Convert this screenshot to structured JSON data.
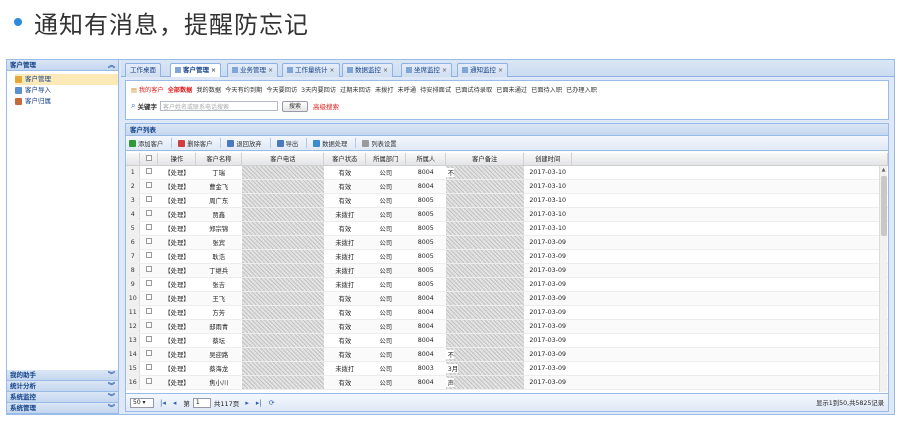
{
  "slide": {
    "title": "通知有消息，提醒防忘记"
  },
  "sidebar": {
    "top_header": "客户管理",
    "items": [
      {
        "label": "客户管理",
        "active": true,
        "icon": "users-icon"
      },
      {
        "label": "客户导入",
        "active": false,
        "icon": "import-icon"
      },
      {
        "label": "客户归属",
        "active": false,
        "icon": "assign-icon"
      }
    ],
    "bottom_sections": [
      {
        "label": "我的助手"
      },
      {
        "label": "统计分析"
      },
      {
        "label": "系统监控"
      },
      {
        "label": "系统管理"
      }
    ]
  },
  "tabs": [
    {
      "label": "工作桌面",
      "active": false,
      "closable": false
    },
    {
      "label": "客户管理",
      "active": true,
      "closable": true
    },
    {
      "label": "业务管理",
      "active": false,
      "closable": true
    },
    {
      "label": "工作量统计",
      "active": false,
      "closable": true
    },
    {
      "label": "数据监控",
      "active": false,
      "closable": true
    },
    {
      "label": "坐席监控",
      "active": false,
      "closable": true
    },
    {
      "label": "通知监控",
      "active": false,
      "closable": true
    }
  ],
  "filters": {
    "quick": [
      {
        "label": "我的客户",
        "style": "red"
      },
      {
        "label": "全部数据",
        "style": "redb"
      },
      {
        "label": "我的数据",
        "style": ""
      },
      {
        "label": "今天有约到期",
        "style": ""
      },
      {
        "label": "今天要回访",
        "style": ""
      },
      {
        "label": "3天内要回访",
        "style": ""
      },
      {
        "label": "过期未回访",
        "style": ""
      },
      {
        "label": "未拨打",
        "style": ""
      },
      {
        "label": "未呼通",
        "style": ""
      },
      {
        "label": "待安排面试",
        "style": ""
      },
      {
        "label": "已面试待录取",
        "style": ""
      },
      {
        "label": "已面未通过",
        "style": ""
      },
      {
        "label": "已面待入职",
        "style": ""
      },
      {
        "label": "已办理入职",
        "style": ""
      }
    ],
    "keyword_label": "关键字",
    "search_placeholder": "客户姓名或联系电话搜索",
    "search_button": "搜索",
    "advanced_link": "高级搜索"
  },
  "list": {
    "title": "客户列表",
    "toolbar": [
      {
        "label": "添加客户",
        "icon": "add-icon",
        "color": "#2e9a3a"
      },
      {
        "label": "删除客户",
        "icon": "delete-icon",
        "color": "#d23c3c"
      },
      {
        "label": "退回放弃",
        "icon": "return-icon",
        "color": "#4a79c2"
      },
      {
        "label": "导出",
        "icon": "export-icon",
        "color": "#4a79c2"
      },
      {
        "label": "数据处理",
        "icon": "process-icon",
        "color": "#3a8bd0"
      },
      {
        "label": "列表设置",
        "icon": "settings-icon",
        "color": "#9a9a9a"
      }
    ],
    "columns": [
      "",
      "",
      "操作",
      "客户名称",
      "客户电话",
      "客户状态",
      "所属部门",
      "所属人",
      "客户备注",
      "创建时间"
    ],
    "rows": [
      {
        "n": "1",
        "op": "【处理】",
        "name": "丁瑞",
        "status": "有效",
        "dept": "公司",
        "owner": "8004",
        "note": "不",
        "date": "2017-03-10"
      },
      {
        "n": "2",
        "op": "【处理】",
        "name": "曹金飞",
        "status": "有效",
        "dept": "公司",
        "owner": "8004",
        "note": "",
        "date": "2017-03-10"
      },
      {
        "n": "3",
        "op": "【处理】",
        "name": "周广东",
        "status": "有效",
        "dept": "公司",
        "owner": "8005",
        "note": "",
        "date": "2017-03-10"
      },
      {
        "n": "4",
        "op": "【处理】",
        "name": "贾鑫",
        "status": "未拨打",
        "dept": "公司",
        "owner": "8005",
        "note": "",
        "date": "2017-03-10"
      },
      {
        "n": "5",
        "op": "【处理】",
        "name": "郑宗锦",
        "status": "有效",
        "dept": "公司",
        "owner": "8005",
        "note": "",
        "date": "2017-03-10"
      },
      {
        "n": "6",
        "op": "【处理】",
        "name": "张宾",
        "status": "未拨打",
        "dept": "公司",
        "owner": "8005",
        "note": "",
        "date": "2017-03-09"
      },
      {
        "n": "7",
        "op": "【处理】",
        "name": "耿浩",
        "status": "未拨打",
        "dept": "公司",
        "owner": "8005",
        "note": "",
        "date": "2017-03-09"
      },
      {
        "n": "8",
        "op": "【处理】",
        "name": "丁继兵",
        "status": "未拨打",
        "dept": "公司",
        "owner": "8005",
        "note": "",
        "date": "2017-03-09"
      },
      {
        "n": "9",
        "op": "【处理】",
        "name": "张吉",
        "status": "未拨打",
        "dept": "公司",
        "owner": "8005",
        "note": "",
        "date": "2017-03-09"
      },
      {
        "n": "10",
        "op": "【处理】",
        "name": "王飞",
        "status": "有效",
        "dept": "公司",
        "owner": "8004",
        "note": "",
        "date": "2017-03-09"
      },
      {
        "n": "11",
        "op": "【处理】",
        "name": "方芳",
        "status": "有效",
        "dept": "公司",
        "owner": "8004",
        "note": "",
        "date": "2017-03-09"
      },
      {
        "n": "12",
        "op": "【处理】",
        "name": "邸雨青",
        "status": "有效",
        "dept": "公司",
        "owner": "8004",
        "note": "",
        "date": "2017-03-09"
      },
      {
        "n": "13",
        "op": "【处理】",
        "name": "蔡坛",
        "status": "有效",
        "dept": "公司",
        "owner": "8004",
        "note": "",
        "date": "2017-03-09"
      },
      {
        "n": "14",
        "op": "【处理】",
        "name": "吴迎路",
        "status": "有效",
        "dept": "公司",
        "owner": "8004",
        "note": "不",
        "date": "2017-03-09"
      },
      {
        "n": "15",
        "op": "【处理】",
        "name": "蔡海龙",
        "status": "未拨打",
        "dept": "公司",
        "owner": "8003",
        "note": "3月",
        "date": "2017-03-09"
      },
      {
        "n": "16",
        "op": "【处理】",
        "name": "焦小川",
        "status": "有效",
        "dept": "公司",
        "owner": "8004",
        "note": "声",
        "date": "2017-03-09"
      }
    ]
  },
  "pager": {
    "page_size": "50",
    "page_label_prefix": "第",
    "page_value": "1",
    "page_label_suffix": "共117页",
    "info": "显示1到50,共5825记录"
  }
}
